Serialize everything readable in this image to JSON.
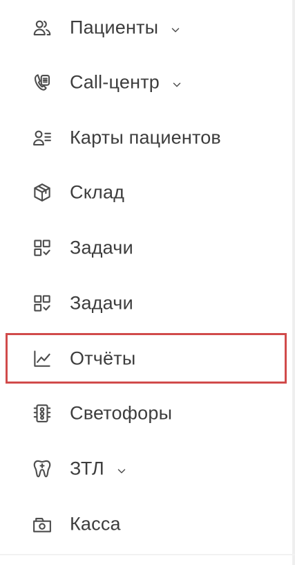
{
  "sidebar": {
    "items": [
      {
        "label": "Пациенты",
        "icon": "patients-icon",
        "expandable": true
      },
      {
        "label": "Call-центр",
        "icon": "call-center-icon",
        "expandable": true
      },
      {
        "label": "Карты пациентов",
        "icon": "patient-cards-icon",
        "expandable": false
      },
      {
        "label": "Склад",
        "icon": "warehouse-box-icon",
        "expandable": false
      },
      {
        "label": "Задачи",
        "icon": "tasks-icon",
        "expandable": false
      },
      {
        "label": "Задачи",
        "icon": "tasks-icon",
        "expandable": false
      },
      {
        "label": "Отчёты",
        "icon": "reports-chart-icon",
        "expandable": false,
        "highlighted": true
      },
      {
        "label": "Светофоры",
        "icon": "traffic-light-icon",
        "expandable": false
      },
      {
        "label": "ЗТЛ",
        "icon": "tooth-icon",
        "expandable": true
      },
      {
        "label": "Касса",
        "icon": "cash-register-icon",
        "expandable": false
      }
    ]
  },
  "colors": {
    "text": "#3d3d3d",
    "icon": "#4d4d4d",
    "highlight_border": "#d14b4b",
    "background": "#ffffff"
  }
}
